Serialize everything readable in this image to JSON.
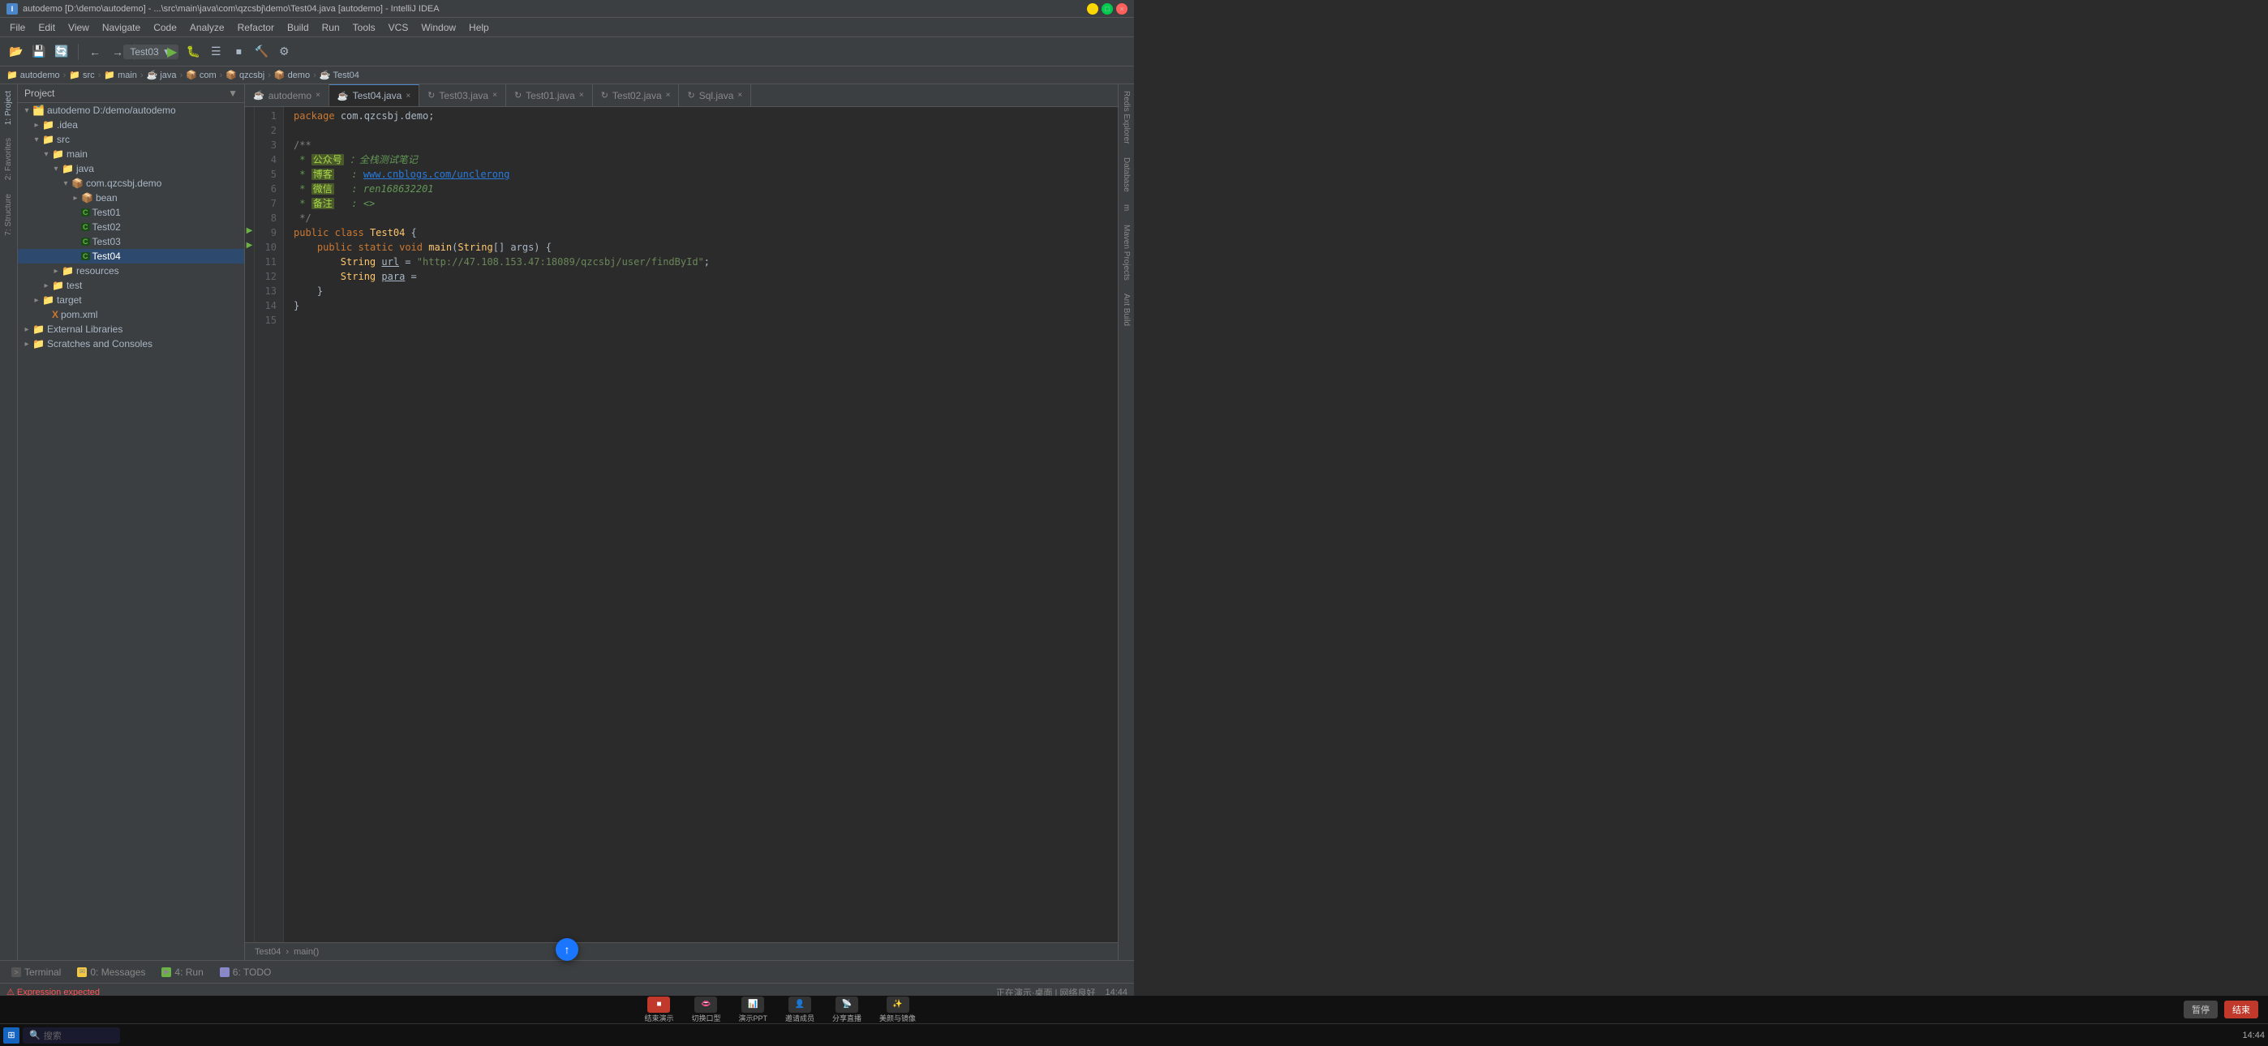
{
  "titleBar": {
    "text": "autodemo [D:\\demo\\autodemo] - ...\\src\\main\\java\\com\\qzcsbj\\demo\\Test04.java [autodemo] - IntelliJ IDEA",
    "minimize": "−",
    "maximize": "□",
    "close": "×"
  },
  "menuBar": {
    "items": [
      "File",
      "Edit",
      "View",
      "Navigate",
      "Code",
      "Analyze",
      "Refactor",
      "Build",
      "Run",
      "Tools",
      "VCS",
      "Window",
      "Help"
    ]
  },
  "toolbar": {
    "runConfig": "Test03",
    "buttons": [
      "📂",
      "💾",
      "🔄",
      "←",
      "→",
      "📋",
      "▶",
      "⚙",
      "☰",
      "⏹",
      "⏬",
      "⏫",
      "🔧",
      "📊",
      "📤"
    ]
  },
  "breadcrumb": {
    "items": [
      "autodemo",
      "src",
      "main",
      "java",
      "com",
      "qzcsbj",
      "demo",
      "Test04"
    ]
  },
  "fileTree": {
    "title": "Project",
    "items": [
      {
        "id": "autodemo-root",
        "label": "autodemo",
        "type": "project",
        "indent": 0,
        "expanded": true,
        "extra": "D:/demo/autodemo"
      },
      {
        "id": "idea",
        "label": ".idea",
        "type": "folder",
        "indent": 1,
        "expanded": false
      },
      {
        "id": "src",
        "label": "src",
        "type": "folder",
        "indent": 1,
        "expanded": true
      },
      {
        "id": "main",
        "label": "main",
        "type": "folder",
        "indent": 2,
        "expanded": true
      },
      {
        "id": "java",
        "label": "java",
        "type": "folder",
        "indent": 3,
        "expanded": true
      },
      {
        "id": "com.qzcsbj.demo",
        "label": "com.qzcsbj.demo",
        "type": "package",
        "indent": 4,
        "expanded": true
      },
      {
        "id": "bean",
        "label": "bean",
        "type": "package",
        "indent": 5,
        "expanded": false
      },
      {
        "id": "Test01",
        "label": "Test01",
        "type": "java",
        "indent": 5
      },
      {
        "id": "Test02",
        "label": "Test02",
        "type": "java",
        "indent": 5
      },
      {
        "id": "Test03",
        "label": "Test03",
        "type": "java",
        "indent": 5
      },
      {
        "id": "Test04",
        "label": "Test04",
        "type": "java",
        "indent": 5,
        "selected": true
      },
      {
        "id": "resources",
        "label": "resources",
        "type": "folder",
        "indent": 3,
        "expanded": false
      },
      {
        "id": "test",
        "label": "test",
        "type": "folder",
        "indent": 2,
        "expanded": false
      },
      {
        "id": "target",
        "label": "target",
        "type": "folder",
        "indent": 1,
        "expanded": false
      },
      {
        "id": "pom.xml",
        "label": "pom.xml",
        "type": "xml",
        "indent": 2
      },
      {
        "id": "external-libs",
        "label": "External Libraries",
        "type": "folder",
        "indent": 0,
        "expanded": false
      },
      {
        "id": "scratches",
        "label": "Scratches and Consoles",
        "type": "folder",
        "indent": 0,
        "expanded": false
      }
    ]
  },
  "tabs": [
    {
      "id": "autodemo",
      "label": "autodemo",
      "icon": "☕",
      "active": false,
      "closable": true
    },
    {
      "id": "Test04.java",
      "label": "Test04.java",
      "icon": "☕",
      "active": true,
      "closable": true
    },
    {
      "id": "Test03.java",
      "label": "Test03.java",
      "icon": "🔄",
      "active": false,
      "closable": true
    },
    {
      "id": "Test01.java",
      "label": "Test01.java",
      "icon": "🔄",
      "active": false,
      "closable": true
    },
    {
      "id": "Test02.java",
      "label": "Test02.java",
      "icon": "🔄",
      "active": false,
      "closable": true
    },
    {
      "id": "Sql.java",
      "label": "Sql.java",
      "icon": "🔄",
      "active": false,
      "closable": true
    }
  ],
  "codeLines": [
    {
      "num": 1,
      "content": "package com.qzcsbj.demo;",
      "type": "normal"
    },
    {
      "num": 2,
      "content": "",
      "type": "normal"
    },
    {
      "num": 3,
      "content": "/**",
      "type": "comment"
    },
    {
      "num": 4,
      "content": " * 公众号 ：全栈测试笔记",
      "type": "cn-comment"
    },
    {
      "num": 5,
      "content": " * 博客   : www.cnblogs.com/unclerong",
      "type": "cn-comment"
    },
    {
      "num": 6,
      "content": " * 微信   : ren168632201",
      "type": "cn-comment"
    },
    {
      "num": 7,
      "content": " * 备注   : <>",
      "type": "cn-comment"
    },
    {
      "num": 8,
      "content": " */",
      "type": "comment"
    },
    {
      "num": 9,
      "content": "public class Test04 {",
      "type": "normal"
    },
    {
      "num": 10,
      "content": "    public static void main(String[] args) {",
      "type": "normal"
    },
    {
      "num": 11,
      "content": "        String url = \"http://47.108.153.47:18089/qzcsbj/user/findById\";",
      "type": "normal"
    },
    {
      "num": 12,
      "content": "        String para =",
      "type": "normal"
    },
    {
      "num": 13,
      "content": "    }",
      "type": "normal"
    },
    {
      "num": 14,
      "content": "}",
      "type": "normal"
    },
    {
      "num": 15,
      "content": "",
      "type": "normal"
    }
  ],
  "editorBreadcrumb": {
    "path": "Test04",
    "method": "main()"
  },
  "bottomTabs": [
    {
      "id": "terminal",
      "label": "Terminal",
      "iconColor": "#555"
    },
    {
      "id": "messages",
      "label": "0: Messages",
      "iconColor": "#f5c842"
    },
    {
      "id": "run",
      "label": "4: Run",
      "iconColor": "#6ab344"
    },
    {
      "id": "todo",
      "label": "6: TODO",
      "iconColor": "#8888cc"
    }
  ],
  "statusBar": {
    "errorText": "Expression expected",
    "position": "",
    "encoding": ""
  },
  "rightPanels": [
    "Redis Explorer",
    "Database",
    "m",
    "Maven Projects",
    "Ant Build"
  ],
  "leftTabs": [
    "1: Project",
    "2: Favorites",
    "7: Structure"
  ],
  "bottomOverlay": {
    "leftItems": [
      "结束演示",
      "切换口型",
      "演示PPT",
      "邀请成员",
      "分享直播",
      "美颜与镜像"
    ],
    "pauseLabel": "暂停",
    "endLabel": "结束"
  },
  "taskbar": {
    "time": "14:44",
    "searchPlaceholder": "搜索"
  }
}
